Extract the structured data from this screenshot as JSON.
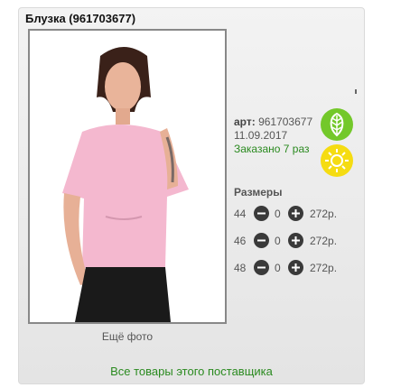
{
  "product": {
    "title": "Блузка (961703677)",
    "article_label": "арт:",
    "article_value": "961703677",
    "date": "11.09.2017",
    "ordered": "Заказано 7 раз"
  },
  "photo": {
    "more_label": "Ещё фото"
  },
  "sizes": {
    "heading": "Размеры",
    "items": [
      {
        "size": "44",
        "qty": "0",
        "price": "272р."
      },
      {
        "size": "46",
        "qty": "0",
        "price": "272р."
      },
      {
        "size": "48",
        "qty": "0",
        "price": "272р."
      }
    ]
  },
  "badges": [
    {
      "icon": "leaf-icon",
      "color": "#73c82a"
    },
    {
      "icon": "sun-icon",
      "color": "#f5dc12"
    }
  ],
  "footer": {
    "all_supplier_link": "Все товары этого поставщика"
  }
}
